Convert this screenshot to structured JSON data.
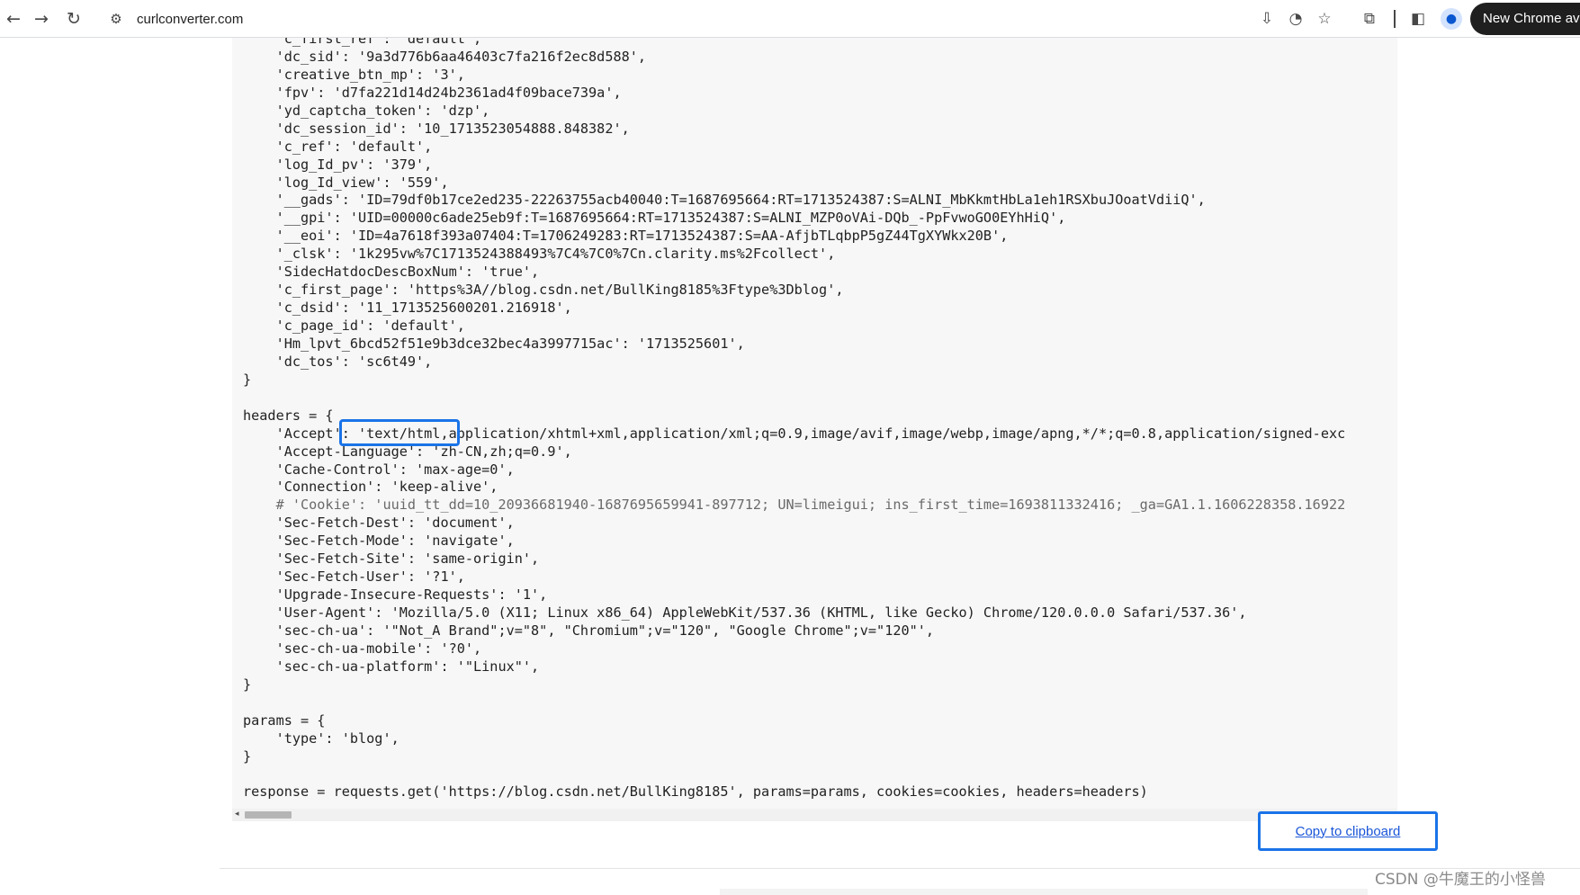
{
  "browser": {
    "url": "curlconverter.com",
    "new_chrome_label": "New Chrome av",
    "icons": {
      "back": "←",
      "forward": "→",
      "reload": "↻",
      "site_info": "⚙",
      "install": "⇩",
      "performance": "◔",
      "bookmark": "☆",
      "extensions": "⧉",
      "side_panel": "◧",
      "profile": "●"
    }
  },
  "code": {
    "lines": [
      "    'c_first_ref': 'default',",
      "    'dc_sid': '9a3d776b6aa46403c7fa216f2ec8d588',",
      "    'creative_btn_mp': '3',",
      "    'fpv': 'd7fa221d14d24b2361ad4f09bace739a',",
      "    'yd_captcha_token': 'dzp',",
      "    'dc_session_id': '10_1713523054888.848382',",
      "    'c_ref': 'default',",
      "    'log_Id_pv': '379',",
      "    'log_Id_view': '559',",
      "    '__gads': 'ID=79df0b17ce2ed235-22263755acb40040:T=1687695664:RT=1713524387:S=ALNI_MbKkmtHbLa1eh1RSXbuJOoatVdiiQ',",
      "    '__gpi': 'UID=00000c6ade25eb9f:T=1687695664:RT=1713524387:S=ALNI_MZP0oVAi-DQb_-PpFvwoGO0EYhHiQ',",
      "    '__eoi': 'ID=4a7618f393a07404:T=1706249283:RT=1713524387:S=AA-AfjbTLqbpP5gZ44TgXYWkx20B',",
      "    '_clsk': '1k295vw%7C1713524388493%7C4%7C0%7Cn.clarity.ms%2Fcollect',",
      "    'SidecHatdocDescBoxNum': 'true',",
      "    'c_first_page': 'https%3A//blog.csdn.net/BullKing8185%3Ftype%3Dblog',",
      "    'c_dsid': '11_1713525600201.216918',",
      "    'c_page_id': 'default',",
      "    'Hm_lpvt_6bcd52f51e9b3dce32bec4a3997715ac': '1713525601',",
      "    'dc_tos': 'sc6t49',",
      "}",
      "",
      "headers = {",
      "    'Accept': 'text/html,application/xhtml+xml,application/xml;q=0.9,image/avif,image/webp,image/apng,*/*;q=0.8,application/signed-exc",
      "    'Accept-Language': 'zh-CN,zh;q=0.9',",
      "    'Cache-Control': 'max-age=0',",
      "    'Connection': 'keep-alive',",
      "    # 'Cookie': 'uuid_tt_dd=10_20936681940-1687695659941-897712; UN=limeigui; ins_first_time=1693811332416; _ga=GA1.1.1606228358.16922",
      "    'Sec-Fetch-Dest': 'document',",
      "    'Sec-Fetch-Mode': 'navigate',",
      "    'Sec-Fetch-Site': 'same-origin',",
      "    'Sec-Fetch-User': '?1',",
      "    'Upgrade-Insecure-Requests': '1',",
      "    'User-Agent': 'Mozilla/5.0 (X11; Linux x86_64) AppleWebKit/537.36 (KHTML, like Gecko) Chrome/120.0.0.0 Safari/537.36',",
      "    'sec-ch-ua': '\"Not_A Brand\";v=\"8\", \"Chromium\";v=\"120\", \"Google Chrome\";v=\"120\"',",
      "    'sec-ch-ua-mobile': '?0',",
      "    'sec-ch-ua-platform': '\"Linux\"',",
      "}",
      "",
      "params = {",
      "    'type': 'blog',",
      "}",
      "",
      "response = requests.get('https://blog.csdn.net/BullKing8185', params=params, cookies=cookies, headers=headers)"
    ],
    "comment_line_index": 26
  },
  "scrollbar": {
    "left_arrow": "◂",
    "right_arrow": "▸"
  },
  "copy_button": {
    "label": "Copy to clipboard"
  },
  "watermark": "CSDN @牛魔王的小怪兽",
  "colors": {
    "highlight": "#1a73e8",
    "link": "#1a55d8",
    "code_bg": "#f7f7f7"
  }
}
